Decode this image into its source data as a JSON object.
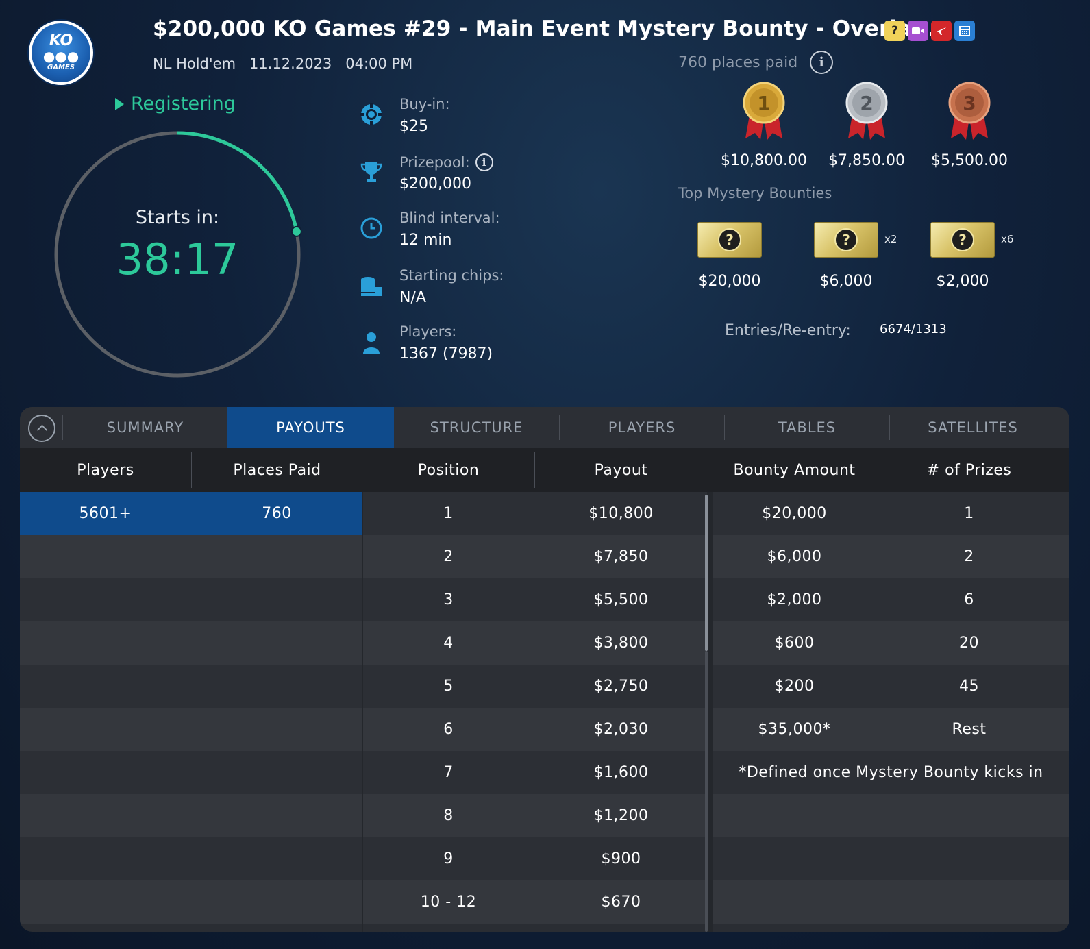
{
  "header": {
    "logo_text_top": "KO",
    "logo_text_bottom": "GAMES",
    "title": "$200,000 KO Games #29 - Main Event Mystery Bounty - Overla...",
    "game": "NL Hold'em",
    "date": "11.12.2023",
    "time": "04:00 PM",
    "title_icons": [
      "mystery-bounty-icon",
      "video-icon",
      "flight-icon",
      "calendar-icon"
    ]
  },
  "status": {
    "label": "Registering",
    "starts_label": "Starts in:",
    "countdown": "38:17",
    "progress_fraction": 0.22,
    "accent": "#2dc99a"
  },
  "info": {
    "buyin_label": "Buy-in:",
    "buyin_value": "$25",
    "prizepool_label": "Prizepool:",
    "prizepool_value": "$200,000",
    "blind_label": "Blind interval:",
    "blind_value": "12 min",
    "chips_label": "Starting chips:",
    "chips_value": "N/A",
    "players_label": "Players:",
    "players_value": "1367 (7987)"
  },
  "prizes": {
    "places_paid": "760 places paid",
    "first": "$10,800.00",
    "second": "$7,850.00",
    "third": "$5,500.00",
    "first_medal": "1",
    "second_medal": "2",
    "third_medal": "3"
  },
  "mystery": {
    "label": "Top Mystery Bounties",
    "b1_amount": "$20,000",
    "b1_mult": "",
    "b2_amount": "$6,000",
    "b2_mult": "x2",
    "b3_amount": "$2,000",
    "b3_mult": "x6",
    "q": "?"
  },
  "entries": {
    "label": "Entries/Re-entry:",
    "value": "6674/1313"
  },
  "tabs": {
    "summary": "SUMMARY",
    "payouts": "PAYOUTS",
    "structure": "STRUCTURE",
    "players": "PLAYERS",
    "tables": "TABLES",
    "satellites": "SATELLITES",
    "active": "payouts",
    "active_color": "#0f4b8c"
  },
  "table": {
    "headers": [
      "Players",
      "Places Paid",
      "Position",
      "Payout",
      "Bounty Amount",
      "# of Prizes"
    ],
    "players_tier": "5601+",
    "places_paid": "760",
    "payouts": [
      {
        "position": "1",
        "payout": "$10,800"
      },
      {
        "position": "2",
        "payout": "$7,850"
      },
      {
        "position": "3",
        "payout": "$5,500"
      },
      {
        "position": "4",
        "payout": "$3,800"
      },
      {
        "position": "5",
        "payout": "$2,750"
      },
      {
        "position": "6",
        "payout": "$2,030"
      },
      {
        "position": "7",
        "payout": "$1,600"
      },
      {
        "position": "8",
        "payout": "$1,200"
      },
      {
        "position": "9",
        "payout": "$900"
      },
      {
        "position": "10 - 12",
        "payout": "$670"
      }
    ],
    "bounties": [
      {
        "amount": "$20,000",
        "prizes": "1"
      },
      {
        "amount": "$6,000",
        "prizes": "2"
      },
      {
        "amount": "$2,000",
        "prizes": "6"
      },
      {
        "amount": "$600",
        "prizes": "20"
      },
      {
        "amount": "$200",
        "prizes": "45"
      },
      {
        "amount": "$35,000*",
        "prizes": "Rest"
      }
    ],
    "footnote": "*Defined once Mystery Bounty kicks in"
  }
}
